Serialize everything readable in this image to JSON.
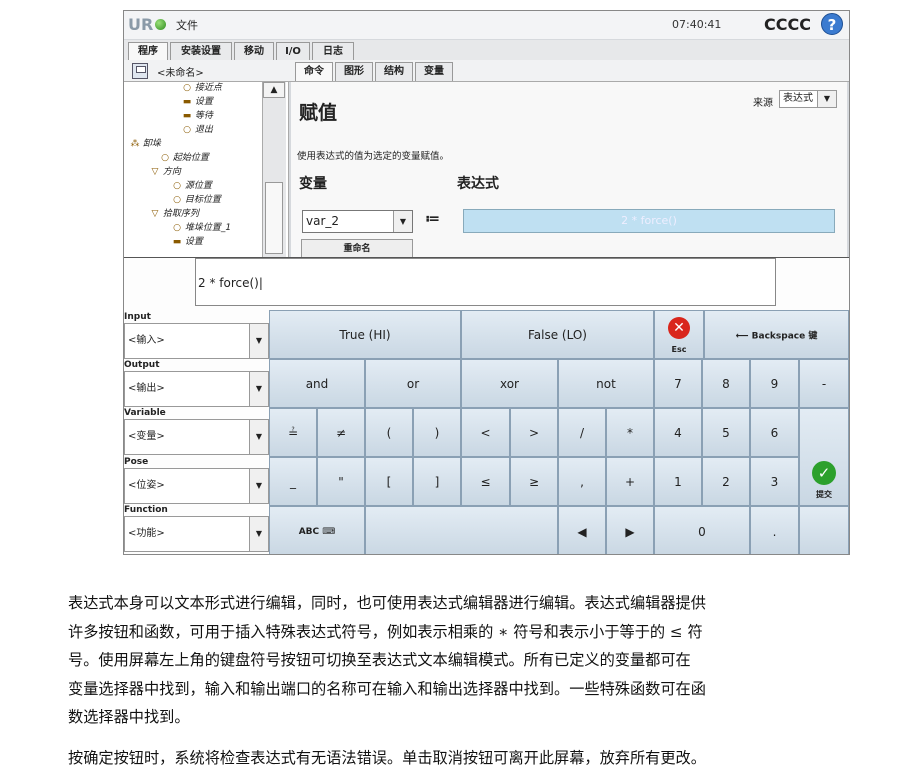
{
  "topbar": {
    "logo": "UR",
    "file_label": "文件",
    "time": "07:40:41",
    "robot_name": "CCCC",
    "help": "?"
  },
  "tabs": [
    "程序",
    "安装设置",
    "移动",
    "I/O",
    "日志"
  ],
  "program": {
    "name": "<未命名>"
  },
  "subtabs": [
    "命令",
    "图形",
    "结构",
    "变量"
  ],
  "tree": [
    {
      "icon": "○",
      "label": "接近点"
    },
    {
      "icon": "▬",
      "label": "设置"
    },
    {
      "icon": "▬",
      "label": "等待"
    },
    {
      "icon": "○",
      "label": "退出"
    },
    {
      "icon": "⁂",
      "label": "卸垛"
    },
    {
      "icon": "○",
      "label": "起始位置"
    },
    {
      "icon": "▽",
      "label": "方向"
    },
    {
      "icon": "○",
      "label": "源位置"
    },
    {
      "icon": "○",
      "label": "目标位置"
    },
    {
      "icon": "▽",
      "label": "拾取序列"
    },
    {
      "icon": "○",
      "label": "堆垛位置_1"
    },
    {
      "icon": "▬",
      "label": "设置"
    }
  ],
  "panel": {
    "title": "赋值",
    "source_label": "来源",
    "source_value": "表达式",
    "description": "使用表达式的值为选定的变量赋值。",
    "var_label": "变量",
    "expr_label": "表达式",
    "var_value": "var_2",
    "assign_op": "≔",
    "expr_value": "2 * force()",
    "rename": "重命名"
  },
  "editor": {
    "expression": "2 * force()|",
    "side": [
      {
        "label": "Input",
        "value": "<输入>"
      },
      {
        "label": "Output",
        "value": "<输出>"
      },
      {
        "label": "Variable",
        "value": "<变量>"
      },
      {
        "label": "Pose",
        "value": "<位姿>"
      },
      {
        "label": "Function",
        "value": "<功能>"
      }
    ],
    "keys": {
      "true": "True (HI)",
      "false": "False (LO)",
      "esc": "Esc",
      "backspace": "⟵ Backspace 键",
      "and": "and",
      "or": "or",
      "xor": "xor",
      "not": "not",
      "k7": "7",
      "k8": "8",
      "k9": "9",
      "minus": "-",
      "assign": "≟",
      "neq": "≠",
      "lparen": "(",
      "rparen": ")",
      "lt": "<",
      "gt": ">",
      "slash": "/",
      "star": "*",
      "k4": "4",
      "k5": "5",
      "k6": "6",
      "underscore": "_",
      "quote": "\"",
      "lbracket": "[",
      "rbracket": "]",
      "le": "≤",
      "ge": "≥",
      "comma": ",",
      "plus": "+",
      "k1": "1",
      "k2": "2",
      "k3": "3",
      "submit": "提交",
      "abc": "ABC ⌨",
      "left": "◀",
      "right": "▶",
      "k0": "0",
      "dot": "."
    }
  },
  "paragraph1": [
    "表达式本身可以文本形式进行编辑，同时，也可使用表达式编辑器进行编辑。表达式编辑器提供",
    "许多按钮和函数，可用于插入特殊表达式符号，例如表示相乘的 ∗ 符号和表示小于等于的 ≤ 符",
    "号。使用屏幕左上角的键盘符号按钮可切换至表达式文本编辑模式。所有已定义的变量都可在",
    "变量选择器中找到，输入和输出端口的名称可在输入和输出选择器中找到。一些特殊函数可在函",
    "数选择器中找到。"
  ],
  "paragraph2": "按确定按钮时，系统将检查表达式有无语法错误。单击取消按钮可离开此屏幕，放弃所有更改。"
}
